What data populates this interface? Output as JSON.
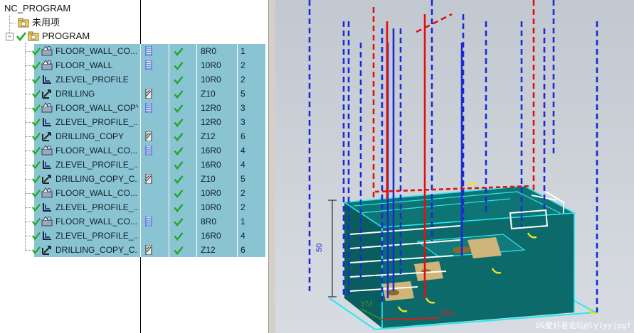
{
  "navigator": {
    "root": "NC_PROGRAM",
    "unused": "未用项",
    "program": "PROGRAM",
    "operations": [
      {
        "name": "FLOOR_WALL_CO...",
        "type": "floor-wall",
        "tool_icon": "mill-tool",
        "tool": "8R0",
        "num": "1"
      },
      {
        "name": "FLOOR_WALL",
        "type": "floor-wall",
        "tool_icon": "mill-tool",
        "tool": "10R0",
        "num": "2"
      },
      {
        "name": "ZLEVEL_PROFILE",
        "type": "zlevel",
        "tool_icon": "",
        "tool": "10R0",
        "num": "2"
      },
      {
        "name": "DRILLING",
        "type": "drilling",
        "tool_icon": "drill-tool",
        "tool": "Z10",
        "num": "5"
      },
      {
        "name": "FLOOR_WALL_COPY",
        "type": "floor-wall",
        "tool_icon": "mill-tool",
        "tool": "12R0",
        "num": "3"
      },
      {
        "name": "ZLEVEL_PROFILE_...",
        "type": "zlevel",
        "tool_icon": "",
        "tool": "12R0",
        "num": "3"
      },
      {
        "name": "DRILLING_COPY",
        "type": "drilling",
        "tool_icon": "drill-tool",
        "tool": "Z12",
        "num": "6"
      },
      {
        "name": "FLOOR_WALL_CO...",
        "type": "floor-wall",
        "tool_icon": "mill-tool",
        "tool": "16R0",
        "num": "4"
      },
      {
        "name": "ZLEVEL_PROFILE_...",
        "type": "zlevel",
        "tool_icon": "",
        "tool": "16R0",
        "num": "4"
      },
      {
        "name": "DRILLING_COPY_C...",
        "type": "drilling",
        "tool_icon": "drill-tool",
        "tool": "Z10",
        "num": "5"
      },
      {
        "name": "FLOOR_WALL_CO...",
        "type": "floor-wall",
        "tool_icon": "",
        "tool": "10R0",
        "num": "2"
      },
      {
        "name": "ZLEVEL_PROFILE_...",
        "type": "zlevel",
        "tool_icon": "",
        "tool": "10R0",
        "num": "2"
      },
      {
        "name": "FLOOR_WALL_CO...",
        "type": "floor-wall",
        "tool_icon": "mill-tool",
        "tool": "8R0",
        "num": "1"
      },
      {
        "name": "ZLEVEL_PROFILE_...",
        "type": "zlevel",
        "tool_icon": "",
        "tool": "16R0",
        "num": "4"
      },
      {
        "name": "DRILLING_COPY_C...",
        "type": "drilling",
        "tool_icon": "drill-tool",
        "tool": "Z12",
        "num": "6"
      }
    ]
  },
  "viewport": {
    "dimension_label": "50",
    "axis_ym": "YM",
    "axis_xm": "XM",
    "watermark": "UG爱好者论坛@lylyyjpgf"
  },
  "colors": {
    "selection": "#8ac4d2",
    "part": "#0d6a6a",
    "path_blue": "#1a2ad8",
    "path_red": "#e01010",
    "edge_cyan": "#27e8f0",
    "check_green": "#1fa81f"
  }
}
